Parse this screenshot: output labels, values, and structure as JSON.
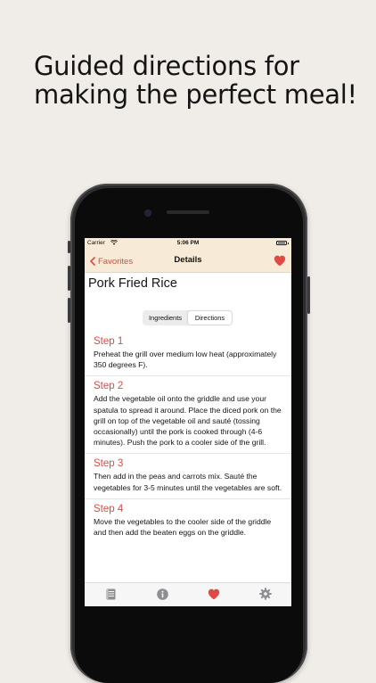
{
  "headline": "Guided directions for making the perfect meal!",
  "status_bar": {
    "carrier": "Carrier",
    "time": "5:06 PM"
  },
  "nav": {
    "back_label": "Favorites",
    "title": "Details"
  },
  "recipe": {
    "title": "Pork Fried Rice"
  },
  "segments": {
    "ingredients": "Ingredients",
    "directions": "Directions",
    "selected": "Directions"
  },
  "steps": [
    {
      "title": "Step 1",
      "text": "Preheat the grill over medium low heat (approximately 350 degrees F)."
    },
    {
      "title": "Step 2",
      "text": "Add the vegetable oil onto the griddle and use your spatula to spread it around. Place the diced pork on the grill on top of the vegetable oil and sauté (tossing occasionally) until the pork is cooked through (4-6 minutes). Push the pork to a cooler side of the grill."
    },
    {
      "title": "Step 3",
      "text": "Then add in the peas and carrots mix. Sauté the vegetables for 3-5 minutes until the vegetables are soft."
    },
    {
      "title": "Step 4",
      "text": "Move the vegetables to the cooler side of the griddle and then add the beaten eggs on the griddle."
    }
  ],
  "tabs": [
    {
      "icon": "book-icon",
      "active": false
    },
    {
      "icon": "info-icon",
      "active": false
    },
    {
      "icon": "heart-icon",
      "active": true
    },
    {
      "icon": "gear-icon",
      "active": false
    }
  ],
  "colors": {
    "accent": "#dd4b45",
    "nav_background": "#f7ead7",
    "page_background": "#f0ece8",
    "inactive_tab": "#8e8e93"
  }
}
